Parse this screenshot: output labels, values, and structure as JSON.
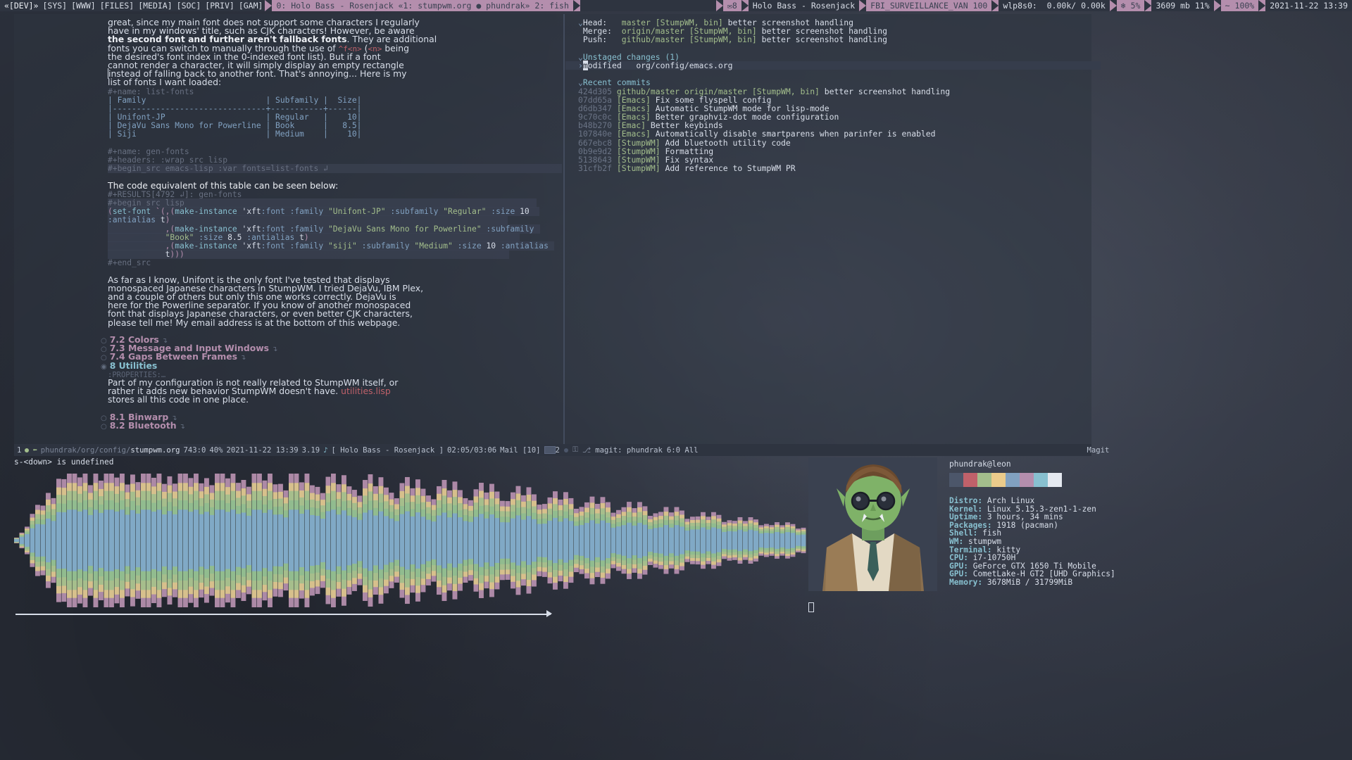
{
  "panel": {
    "groups": [
      {
        "label": "«[DEV]»",
        "active": true
      },
      {
        "label": "[SYS]",
        "active": false
      },
      {
        "label": "[WWW]",
        "active": false
      },
      {
        "label": "[FILES]",
        "active": false
      },
      {
        "label": "[MEDIA]",
        "active": false
      },
      {
        "label": "[SOC]",
        "active": false
      },
      {
        "label": "[PRIV]",
        "active": false
      },
      {
        "label": "[GAM]",
        "active": false
      }
    ],
    "windows": "0: Holo Bass - Rosenjack «1: stumpwm.org  ●  phundrak» 2: fish",
    "mail_icon": "mail-icon",
    "mail_count": "8",
    "now_playing": "Holo Bass - Rosenjack",
    "wifi_ssid": "FBI_SURVEILLANCE_VAN 100",
    "net_iface": "wlp8s0:",
    "net_rates": "0.00k/ 0.00k",
    "cpu_icon": "cpu-icon",
    "cpu": "5%",
    "mem": "3609 mb 11%",
    "bat_icon": "~",
    "bat": "100%",
    "clock": "2021-11-22 13:39"
  },
  "org": {
    "prose_top": [
      "great, since my main font does not support some characters I regularly",
      "have in my windows' title, such as CJK characters! However, be aware"
    ],
    "bold_warn": "the second font and further aren't fallback fonts",
    "warn_tail": ". They are additional",
    "prose_mid_a": "fonts you can switch to manually through the use of ",
    "code_fn": "^f<n>",
    "code_paren_a": " (",
    "code_n": "<n>",
    "code_paren_b": " being",
    "prose_mid_b": "the desired's font index in the 0-indexed font list). But if a font",
    "prose_mid_c": "cannot render a character, it will simply display an empty rectangle",
    "prose_mid_d": "instead of falling back to another font. That's annoying... Here is my",
    "prose_mid_e": "list of fonts I want loaded:",
    "name_list_fonts": "#+name: list-fonts",
    "table": {
      "headers": [
        "Family",
        "Subfamily",
        "Size"
      ],
      "rows": [
        [
          "Unifont-JP",
          "Regular",
          "10"
        ],
        [
          "DejaVu Sans Mono for Powerline",
          "Book",
          "8.5"
        ],
        [
          "Siji",
          "Medium",
          "10"
        ]
      ]
    },
    "name_gen_fonts": "#+name: gen-fonts",
    "headers_line": "#+headers: :wrap src lisp",
    "begin_src_emacs": "#+begin_src emacs-lisp :var fonts=list-fonts ↲",
    "code_eq_line": "The code equivalent of this table can be seen below:",
    "results_line": "#+RESULTS[4792 ↲]: gen-fonts",
    "begin_src_lisp": "#+begin_src lisp",
    "end_src": "#+end_src",
    "code_lines": [
      "(set-font `(,(make-instance 'xft:font :family \"Unifont-JP\" :subfamily \"Regular\" :size 10",
      ":antialias t)",
      "            ,(make-instance 'xft:font :family \"DejaVu Sans Mono for Powerline\" :subfamily",
      "            \"Book\" :size 8.5 :antialias t)",
      "            ,(make-instance 'xft:font :family \"siji\" :subfamily \"Medium\" :size 10 :antialias",
      "            t)))"
    ],
    "prose_bottom": [
      "As far as I know, Unifont is the only font I've tested that displays",
      "monospaced Japanese characters in StumpWM. I tried DejaVu, IBM Plex,",
      "and a couple of others but only this one works correctly. DejaVu is",
      "here for the Powerline separator. If you know of another monospaced",
      "font that displays Japanese characters, or even better CJK characters,",
      "please tell me! My email address is at the bottom of this webpage."
    ],
    "headings": [
      {
        "label": "7.2 Colors",
        "level": 2,
        "collapsed": true
      },
      {
        "label": "7.3 Message and Input Windows",
        "level": 2,
        "collapsed": true
      },
      {
        "label": "7.4 Gaps Between Frames",
        "level": 2,
        "collapsed": true
      },
      {
        "label": "8 Utilities",
        "level": 1,
        "collapsed": false
      }
    ],
    "properties_line": ":PROPERTIES:…",
    "util_text_a": "Part of my configuration is not really related to StumpWM itself, or",
    "util_text_b_pre": "rather it adds new behavior StumpWM doesn't have. ",
    "util_link": "utilities.lisp",
    "util_text_c": "stores all this code in one place.",
    "sub_headings": [
      {
        "label": "8.1 Binwarp",
        "collapsed": true
      },
      {
        "label": "8.2 Bluetooth",
        "collapsed": true
      }
    ]
  },
  "magit": {
    "head_key": "Head:",
    "head_branch": "master",
    "head_tags": "[StumpWM, bin]",
    "head_msg": "better screenshot handling",
    "merge_key": "Merge:",
    "merge_branch": "origin/master",
    "merge_tags": "[StumpWM, bin]",
    "merge_msg": "better screenshot handling",
    "push_key": "Push:",
    "push_branch": "github/master",
    "push_tags": "[StumpWM, bin]",
    "push_msg": "better screenshot handling",
    "unstaged_title": "Unstaged changes (1)",
    "unstaged_status": "modified",
    "unstaged_file": "org/config/emacs.org",
    "recent_title": "Recent commits",
    "commits": [
      {
        "hash": "424d305",
        "refs": "github/master origin/master",
        "tag": "[StumpWM, bin]",
        "msg": "better screenshot handling"
      },
      {
        "hash": "07dd65a",
        "refs": "",
        "tag": "[Emacs]",
        "msg": "Fix some flyspell config"
      },
      {
        "hash": "d6db347",
        "refs": "",
        "tag": "[Emacs]",
        "msg": "Automatic StumpWM mode for lisp-mode"
      },
      {
        "hash": "9c70c0c",
        "refs": "",
        "tag": "[Emacs]",
        "msg": "Better graphviz-dot mode configuration"
      },
      {
        "hash": "b48b270",
        "refs": "",
        "tag": "[Emac]",
        "msg": "Better keybinds"
      },
      {
        "hash": "107840e",
        "refs": "",
        "tag": "[Emacs]",
        "msg": "Automatically disable smartparens when parinfer is enabled"
      },
      {
        "hash": "667ebc8",
        "refs": "",
        "tag": "[StumpWM]",
        "msg": "Add bluetooth utility code"
      },
      {
        "hash": "0b9e9d2",
        "refs": "",
        "tag": "[StumpWM]",
        "msg": "Formatting"
      },
      {
        "hash": "5138643",
        "refs": "",
        "tag": "[StumpWM]",
        "msg": "Fix syntax"
      },
      {
        "hash": "31cfb2f",
        "refs": "",
        "tag": "[StumpWM]",
        "msg": "Add reference to StumpWM PR"
      }
    ]
  },
  "modeline": {
    "win_num": "1",
    "buffer_dir": "phundrak/org/config/",
    "buffer_name": "stumpwm.org",
    "position": "743:0",
    "percent": "40%",
    "date": "2021-11-22 13:39",
    "version": "3.19",
    "music_icon": "music-note-icon",
    "music": "[ Holo Bass - Rosenjack ]",
    "music_time": "02:05/03:06",
    "mail": "Mail [10]",
    "right_win_num": "2",
    "magit_buffer": "magit: phundrak",
    "magit_pos": "6:0 All",
    "magit_mode": "Magit"
  },
  "minibuffer": {
    "message": "s-<down> is undefined"
  },
  "neofetch": {
    "user": "phundrak@leon",
    "palette": [
      "#4c566a",
      "#bf616a",
      "#a3be8c",
      "#ebcb8b",
      "#81a1c1",
      "#b48ead",
      "#88c0d0",
      "#e5e9f0"
    ],
    "rows": [
      {
        "key": "Distro:",
        "value": "Arch Linux"
      },
      {
        "key": "Kernel:",
        "value": "Linux 5.15.3-zen1-1-zen"
      },
      {
        "key": "Uptime:",
        "value": "3 hours, 34 mins"
      },
      {
        "key": "Packages:",
        "value": "1918 (pacman)"
      },
      {
        "key": "Shell:",
        "value": "fish"
      },
      {
        "key": "WM:",
        "value": "stumpwm"
      },
      {
        "key": "Terminal:",
        "value": "kitty"
      },
      {
        "key": "CPU:",
        "value": "i7-10750H"
      },
      {
        "key": "GPU:",
        "value": "GeForce GTX 1650 Ti Mobile"
      },
      {
        "key": "GPU:",
        "value": "CometLake-H GT2 [UHD Graphics]"
      },
      {
        "key": "Memory:",
        "value": "3678MiB / 31799MiB"
      }
    ]
  },
  "colors": {
    "accent_pink": "#b48ead",
    "accent_blue": "#88c0d0",
    "bg": "#2e3440",
    "fg": "#d8dee9"
  }
}
